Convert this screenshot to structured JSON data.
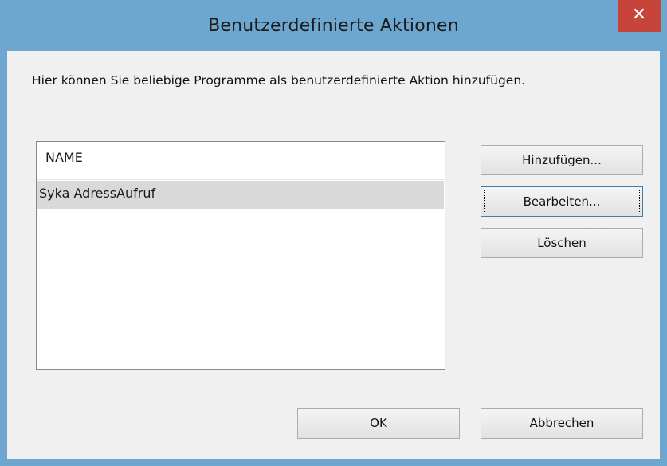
{
  "window": {
    "title": "Benutzerdefinierte Aktionen",
    "close_symbol": "✕"
  },
  "description": "Hier können Sie beliebige Programme als benutzerdefinierte Aktion hinzufügen.",
  "list": {
    "header": "NAME",
    "rows": [
      "Syka AdressAufruf"
    ],
    "selected_index": 0
  },
  "buttons": {
    "add": "Hinzufügen...",
    "edit": "Bearbeiten...",
    "delete": "Löschen",
    "ok": "OK",
    "cancel": "Abbrechen"
  },
  "colors": {
    "frame": "#6da7cf",
    "close_button": "#c7443a",
    "client_background": "#f0f0f0",
    "selected_row": "#d9d9d9"
  }
}
